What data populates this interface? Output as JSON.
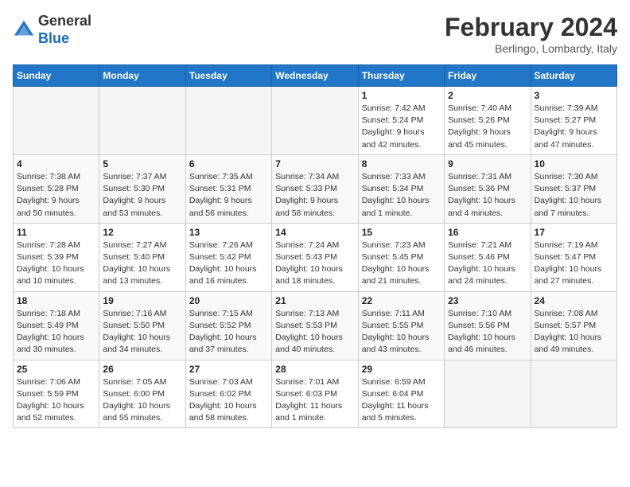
{
  "header": {
    "logo_general": "General",
    "logo_blue": "Blue",
    "month_year": "February 2024",
    "location": "Berlingo, Lombardy, Italy"
  },
  "weekdays": [
    "Sunday",
    "Monday",
    "Tuesday",
    "Wednesday",
    "Thursday",
    "Friday",
    "Saturday"
  ],
  "weeks": [
    [
      {
        "day": "",
        "info": ""
      },
      {
        "day": "",
        "info": ""
      },
      {
        "day": "",
        "info": ""
      },
      {
        "day": "",
        "info": ""
      },
      {
        "day": "1",
        "info": "Sunrise: 7:42 AM\nSunset: 5:24 PM\nDaylight: 9 hours\nand 42 minutes."
      },
      {
        "day": "2",
        "info": "Sunrise: 7:40 AM\nSunset: 5:26 PM\nDaylight: 9 hours\nand 45 minutes."
      },
      {
        "day": "3",
        "info": "Sunrise: 7:39 AM\nSunset: 5:27 PM\nDaylight: 9 hours\nand 47 minutes."
      }
    ],
    [
      {
        "day": "4",
        "info": "Sunrise: 7:38 AM\nSunset: 5:28 PM\nDaylight: 9 hours\nand 50 minutes."
      },
      {
        "day": "5",
        "info": "Sunrise: 7:37 AM\nSunset: 5:30 PM\nDaylight: 9 hours\nand 53 minutes."
      },
      {
        "day": "6",
        "info": "Sunrise: 7:35 AM\nSunset: 5:31 PM\nDaylight: 9 hours\nand 56 minutes."
      },
      {
        "day": "7",
        "info": "Sunrise: 7:34 AM\nSunset: 5:33 PM\nDaylight: 9 hours\nand 58 minutes."
      },
      {
        "day": "8",
        "info": "Sunrise: 7:33 AM\nSunset: 5:34 PM\nDaylight: 10 hours\nand 1 minute."
      },
      {
        "day": "9",
        "info": "Sunrise: 7:31 AM\nSunset: 5:36 PM\nDaylight: 10 hours\nand 4 minutes."
      },
      {
        "day": "10",
        "info": "Sunrise: 7:30 AM\nSunset: 5:37 PM\nDaylight: 10 hours\nand 7 minutes."
      }
    ],
    [
      {
        "day": "11",
        "info": "Sunrise: 7:28 AM\nSunset: 5:39 PM\nDaylight: 10 hours\nand 10 minutes."
      },
      {
        "day": "12",
        "info": "Sunrise: 7:27 AM\nSunset: 5:40 PM\nDaylight: 10 hours\nand 13 minutes."
      },
      {
        "day": "13",
        "info": "Sunrise: 7:26 AM\nSunset: 5:42 PM\nDaylight: 10 hours\nand 16 minutes."
      },
      {
        "day": "14",
        "info": "Sunrise: 7:24 AM\nSunset: 5:43 PM\nDaylight: 10 hours\nand 18 minutes."
      },
      {
        "day": "15",
        "info": "Sunrise: 7:23 AM\nSunset: 5:45 PM\nDaylight: 10 hours\nand 21 minutes."
      },
      {
        "day": "16",
        "info": "Sunrise: 7:21 AM\nSunset: 5:46 PM\nDaylight: 10 hours\nand 24 minutes."
      },
      {
        "day": "17",
        "info": "Sunrise: 7:19 AM\nSunset: 5:47 PM\nDaylight: 10 hours\nand 27 minutes."
      }
    ],
    [
      {
        "day": "18",
        "info": "Sunrise: 7:18 AM\nSunset: 5:49 PM\nDaylight: 10 hours\nand 30 minutes."
      },
      {
        "day": "19",
        "info": "Sunrise: 7:16 AM\nSunset: 5:50 PM\nDaylight: 10 hours\nand 34 minutes."
      },
      {
        "day": "20",
        "info": "Sunrise: 7:15 AM\nSunset: 5:52 PM\nDaylight: 10 hours\nand 37 minutes."
      },
      {
        "day": "21",
        "info": "Sunrise: 7:13 AM\nSunset: 5:53 PM\nDaylight: 10 hours\nand 40 minutes."
      },
      {
        "day": "22",
        "info": "Sunrise: 7:11 AM\nSunset: 5:55 PM\nDaylight: 10 hours\nand 43 minutes."
      },
      {
        "day": "23",
        "info": "Sunrise: 7:10 AM\nSunset: 5:56 PM\nDaylight: 10 hours\nand 46 minutes."
      },
      {
        "day": "24",
        "info": "Sunrise: 7:08 AM\nSunset: 5:57 PM\nDaylight: 10 hours\nand 49 minutes."
      }
    ],
    [
      {
        "day": "25",
        "info": "Sunrise: 7:06 AM\nSunset: 5:59 PM\nDaylight: 10 hours\nand 52 minutes."
      },
      {
        "day": "26",
        "info": "Sunrise: 7:05 AM\nSunset: 6:00 PM\nDaylight: 10 hours\nand 55 minutes."
      },
      {
        "day": "27",
        "info": "Sunrise: 7:03 AM\nSunset: 6:02 PM\nDaylight: 10 hours\nand 58 minutes."
      },
      {
        "day": "28",
        "info": "Sunrise: 7:01 AM\nSunset: 6:03 PM\nDaylight: 11 hours\nand 1 minute."
      },
      {
        "day": "29",
        "info": "Sunrise: 6:59 AM\nSunset: 6:04 PM\nDaylight: 11 hours\nand 5 minutes."
      },
      {
        "day": "",
        "info": ""
      },
      {
        "day": "",
        "info": ""
      }
    ]
  ]
}
